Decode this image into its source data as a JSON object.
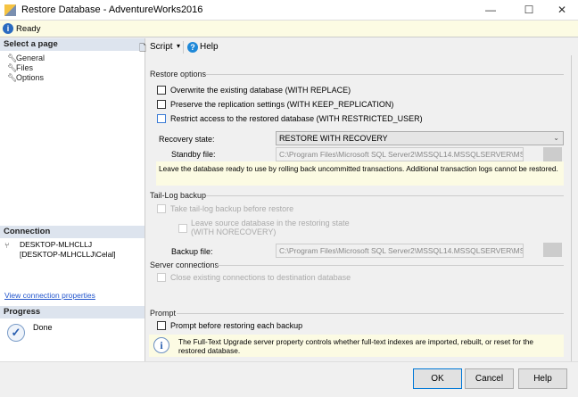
{
  "window": {
    "title": "Restore Database - AdventureWorks2016",
    "minimize": "—",
    "maximize": "☐",
    "close": "✕"
  },
  "status": {
    "text": "Ready"
  },
  "left": {
    "select_header": "Select a page",
    "pages": [
      {
        "label": "General"
      },
      {
        "label": "Files"
      },
      {
        "label": "Options"
      }
    ],
    "connection_header": "Connection",
    "server": "DESKTOP-MLHCLLJ",
    "user": "[DESKTOP-MLHCLLJ\\Celal]",
    "view_link": "View connection properties",
    "progress_header": "Progress",
    "progress_status": "Done"
  },
  "toolbar": {
    "script": "Script",
    "help": "Help"
  },
  "restore_options": {
    "header": "Restore options",
    "overwrite": "Overwrite the existing database (WITH REPLACE)",
    "preserve": "Preserve the replication settings (WITH KEEP_REPLICATION)",
    "restrict": "Restrict access to the restored database (WITH RESTRICTED_USER)",
    "recovery_label": "Recovery state:",
    "recovery_value": "RESTORE WITH RECOVERY",
    "standby_label": "Standby file:",
    "standby_value": "C:\\Program Files\\Microsoft SQL Server2\\MSSQL14.MSSQLSERVER\\MSSQ",
    "note": "Leave the database ready to use by rolling back uncommitted transactions. Additional transaction logs cannot be restored."
  },
  "tail_log": {
    "header": "Tail-Log backup",
    "take": "Take tail-log backup before restore",
    "leave_line1": "Leave source database in the restoring state",
    "leave_line2": "(WITH NORECOVERY)",
    "backup_label": "Backup file:",
    "backup_value": "C:\\Program Files\\Microsoft SQL Server2\\MSSQL14.MSSQLSERVER\\MSSQ"
  },
  "server_connections": {
    "header": "Server connections",
    "close": "Close existing connections to destination database"
  },
  "prompt": {
    "header": "Prompt",
    "prompt_before": "Prompt before restoring each backup",
    "info": "The Full-Text Upgrade server property controls whether full-text indexes are imported, rebuilt, or reset for the restored database."
  },
  "buttons": {
    "ok": "OK",
    "cancel": "Cancel",
    "help": "Help"
  }
}
